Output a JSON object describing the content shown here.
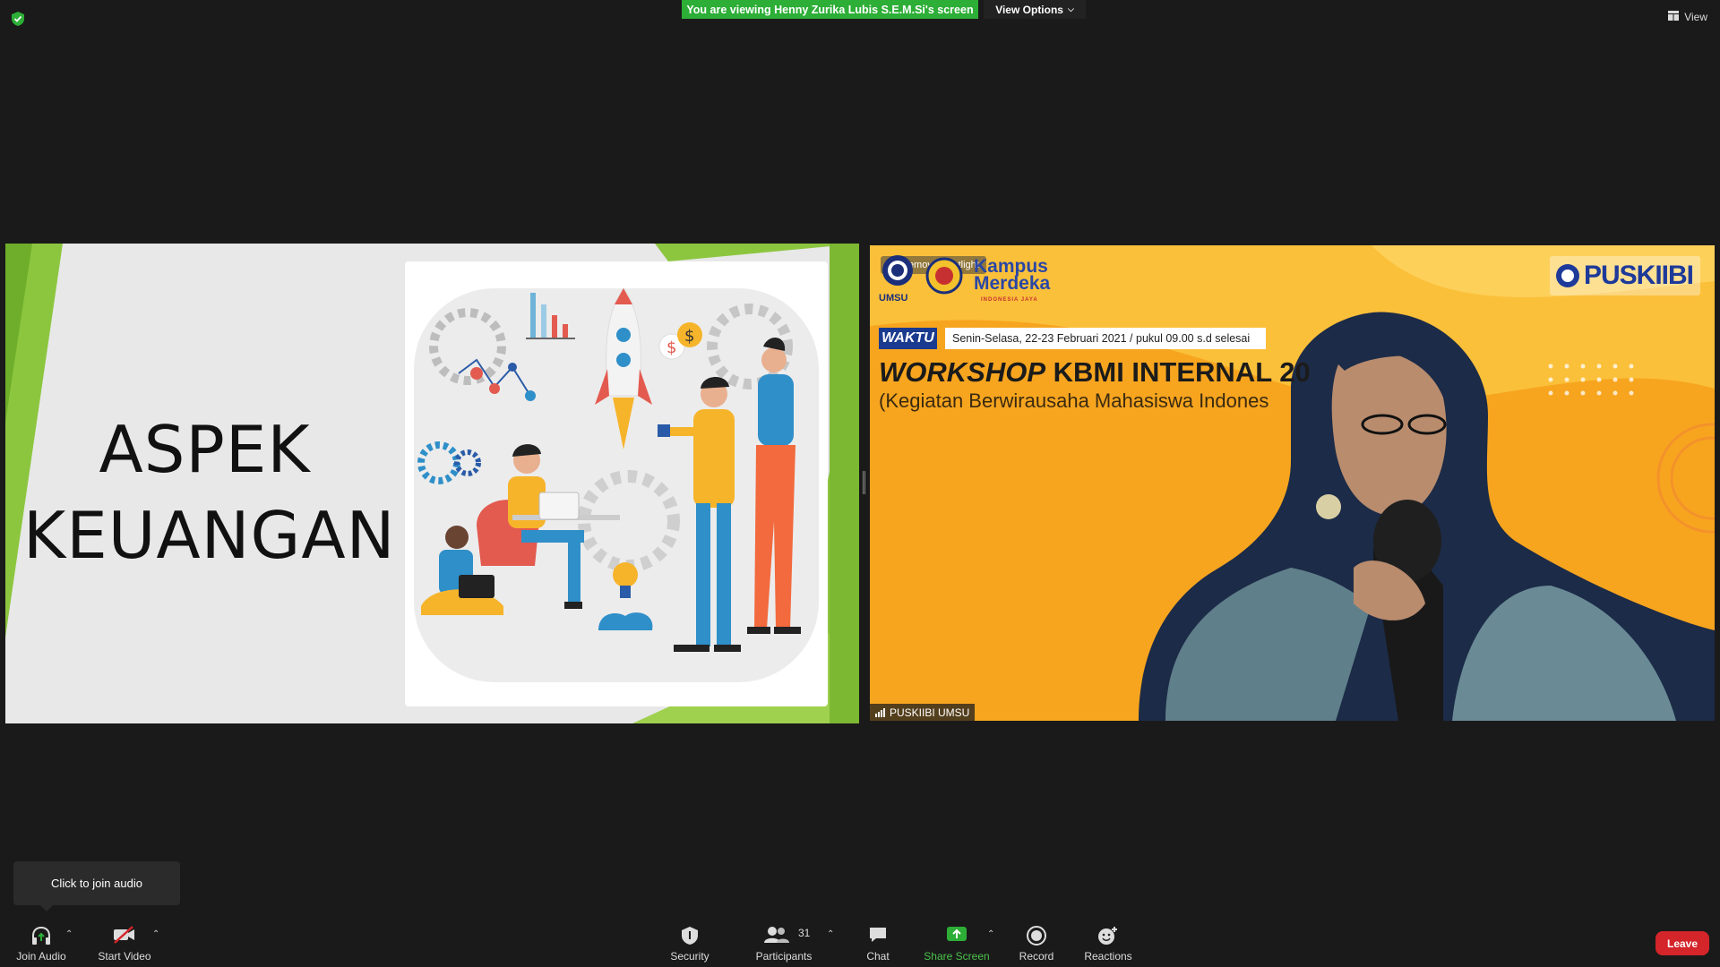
{
  "top": {
    "viewing_banner": "You are viewing Henny Zurika Lubis S.E.M.Si's screen",
    "view_options": "View Options",
    "view_button": "View"
  },
  "slide": {
    "title_line1": "ASPEK",
    "title_line2": "KEUANGAN"
  },
  "video": {
    "remove_spotlight": "Remove Spotlight",
    "waktu_label": "WAKTU",
    "waktu_text": "Senin-Selasa,  22-23 Februari 2021 / pukul 09.00 s.d selesai",
    "workshop_bold_italic": "WORKSHOP",
    "workshop_rest": " KBMI INTERNAL 20",
    "subtitle": "(Kegiatan Berwirausaha Mahasiswa Indones",
    "umsu_label": "UMSU",
    "kampus_label": "Kampus",
    "merdeka_label": "Merdeka",
    "indonesia_jaya": "INDONESIA JAYA",
    "puskiibi_logo": "PUSKIIBI",
    "participant_name": "PUSKIIBI UMSU"
  },
  "tooltip": {
    "join_audio_tip": "Click to join audio"
  },
  "toolbar": {
    "join_audio": "Join Audio",
    "start_video": "Start Video",
    "security": "Security",
    "participants": "Participants",
    "participants_count": "31",
    "chat": "Chat",
    "share_screen": "Share Screen",
    "record": "Record",
    "reactions": "Reactions",
    "leave": "Leave"
  },
  "colors": {
    "share_green": "#2dae37",
    "leave_red": "#d4252a",
    "video_orange": "#f7a51f",
    "slide_green": "#8cc63f"
  }
}
